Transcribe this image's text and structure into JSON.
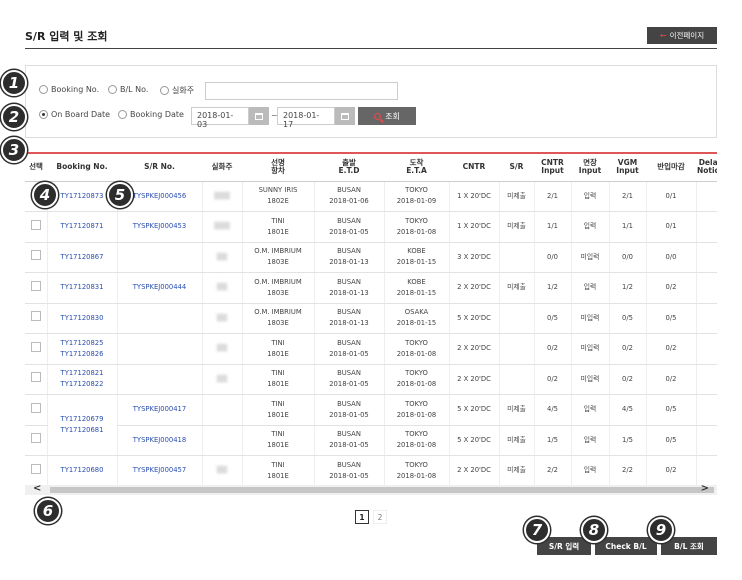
{
  "header": {
    "title": "S/R 입력 및 조회",
    "back_label": "이전페이지",
    "back_arrow": "←"
  },
  "search": {
    "radios_row1": [
      "Booking No.",
      "B/L No.",
      "실화주"
    ],
    "radios_row2": [
      "On Board Date",
      "Booking Date"
    ],
    "selected_row2": "On Board Date",
    "text_value": "",
    "date_from": "2018-01-03",
    "date_to": "2018-01-17",
    "date_separator": "~",
    "query_label": "조회"
  },
  "table": {
    "headers": [
      "선택",
      "Booking No.",
      "S/R No.",
      "실화주",
      "선명\n항차",
      "출발\nE.T.D",
      "도착\nE.T.A",
      "CNTR",
      "S/R",
      "CNTR\nInput",
      "면장\nInput",
      "VGM\nInput",
      "반입마감",
      "Delay\nNotice"
    ],
    "rows": [
      {
        "booking": [
          "TY17120873"
        ],
        "sr": "TYSPKEJ000456",
        "shipper": "▒▒▒",
        "vessel": "SUNNY IRIS",
        "voyage": "1802E",
        "etd_port": "BUSAN",
        "etd": "2018-01-06",
        "eta_port": "TOKYO",
        "eta": "2018-01-09",
        "cntr": "1 X 20'DC",
        "sr_status": "미제출",
        "cntr_in": "2/1",
        "lic_in": "입력",
        "vgm_in": "2/1",
        "cutoff": "0/1",
        "delay": ""
      },
      {
        "booking": [
          "TY17120871"
        ],
        "sr": "TYSPKEJ000453",
        "shipper": "▒▒▒",
        "vessel": "TINI",
        "voyage": "1801E",
        "etd_port": "BUSAN",
        "etd": "2018-01-05",
        "eta_port": "TOKYO",
        "eta": "2018-01-08",
        "cntr": "1 X 20'DC",
        "sr_status": "미제출",
        "cntr_in": "1/1",
        "lic_in": "입력",
        "vgm_in": "1/1",
        "cutoff": "0/1",
        "delay": ""
      },
      {
        "booking": [
          "TY17120867"
        ],
        "sr": "",
        "shipper": "▒▒",
        "vessel": "O.M. IMBRIUM",
        "voyage": "1803E",
        "etd_port": "BUSAN",
        "etd": "2018-01-13",
        "eta_port": "KOBE",
        "eta": "2018-01-15",
        "cntr": "3 X 20'DC",
        "sr_status": "",
        "cntr_in": "0/0",
        "lic_in": "미입력",
        "vgm_in": "0/0",
        "cutoff": "0/0",
        "delay": ""
      },
      {
        "booking": [
          "TY17120831"
        ],
        "sr": "TYSPKEJ000444",
        "shipper": "▒▒",
        "vessel": "O.M. IMBRIUM",
        "voyage": "1803E",
        "etd_port": "BUSAN",
        "etd": "2018-01-13",
        "eta_port": "KOBE",
        "eta": "2018-01-15",
        "cntr": "2 X 20'DC",
        "sr_status": "미제출",
        "cntr_in": "1/2",
        "lic_in": "입력",
        "vgm_in": "1/2",
        "cutoff": "0/2",
        "delay": ""
      },
      {
        "booking": [
          "TY17120830"
        ],
        "sr": "",
        "shipper": "▒▒",
        "vessel": "O.M. IMBRIUM",
        "voyage": "1803E",
        "etd_port": "BUSAN",
        "etd": "2018-01-13",
        "eta_port": "OSAKA",
        "eta": "2018-01-15",
        "cntr": "5 X 20'DC",
        "sr_status": "",
        "cntr_in": "0/5",
        "lic_in": "미입력",
        "vgm_in": "0/5",
        "cutoff": "0/5",
        "delay": ""
      },
      {
        "booking": [
          "TY17120825",
          "TY17120826"
        ],
        "sr": "",
        "shipper": "▒▒",
        "vessel": "TINI",
        "voyage": "1801E",
        "etd_port": "BUSAN",
        "etd": "2018-01-05",
        "eta_port": "TOKYO",
        "eta": "2018-01-08",
        "cntr": "2 X 20'DC",
        "sr_status": "",
        "cntr_in": "0/2",
        "lic_in": "미입력",
        "vgm_in": "0/2",
        "cutoff": "0/2",
        "delay": ""
      },
      {
        "booking": [
          "TY17120821",
          "TY17120822"
        ],
        "sr": "",
        "shipper": "▒▒",
        "vessel": "TINI",
        "voyage": "1801E",
        "etd_port": "BUSAN",
        "etd": "2018-01-05",
        "eta_port": "TOKYO",
        "eta": "2018-01-08",
        "cntr": "2 X 20'DC",
        "sr_status": "",
        "cntr_in": "0/2",
        "lic_in": "미입력",
        "vgm_in": "0/2",
        "cutoff": "0/2",
        "delay": ""
      },
      {
        "booking": [
          "TY17120679",
          "TY17120681"
        ],
        "booking_rowspan": 2,
        "sr": "TYSPKEJ000417",
        "shipper": "",
        "vessel": "TINI",
        "voyage": "1801E",
        "etd_port": "BUSAN",
        "etd": "2018-01-05",
        "eta_port": "TOKYO",
        "eta": "2018-01-08",
        "cntr": "5 X 20'DC",
        "sr_status": "미제출",
        "cntr_in": "4/5",
        "lic_in": "입력",
        "vgm_in": "4/5",
        "cutoff": "0/5",
        "delay": ""
      },
      {
        "booking": [],
        "booking_merged": true,
        "sr": "TYSPKEJ000418",
        "shipper": "",
        "vessel": "TINI",
        "voyage": "1801E",
        "etd_port": "BUSAN",
        "etd": "2018-01-05",
        "eta_port": "TOKYO",
        "eta": "2018-01-08",
        "cntr": "5 X 20'DC",
        "sr_status": "미제출",
        "cntr_in": "1/5",
        "lic_in": "입력",
        "vgm_in": "1/5",
        "cutoff": "0/5",
        "delay": ""
      },
      {
        "booking": [
          "TY17120680"
        ],
        "sr": "TYSPKEJ000457",
        "shipper": "▒▒",
        "vessel": "TINI",
        "voyage": "1801E",
        "etd_port": "BUSAN",
        "etd": "2018-01-05",
        "eta_port": "TOKYO",
        "eta": "2018-01-08",
        "cntr": "2 X 20'DC",
        "sr_status": "미제출",
        "cntr_in": "2/2",
        "lic_in": "입력",
        "vgm_in": "2/2",
        "cutoff": "0/2",
        "delay": ""
      }
    ]
  },
  "scroll": {
    "left": "<",
    "right": ">"
  },
  "pagination": {
    "pages": [
      "1",
      "2"
    ],
    "current": "1"
  },
  "actions": {
    "sr_input": "S/R 입력",
    "check_bl": "Check B/L",
    "bl_query": "B/L 조회"
  },
  "badges": [
    "1",
    "2",
    "3",
    "4",
    "5",
    "6",
    "7",
    "8",
    "9"
  ],
  "colors": {
    "accent_red": "#e05555",
    "link_blue": "#2a4fb0",
    "dark_button": "#444444",
    "badge": "#2d2d2d"
  }
}
